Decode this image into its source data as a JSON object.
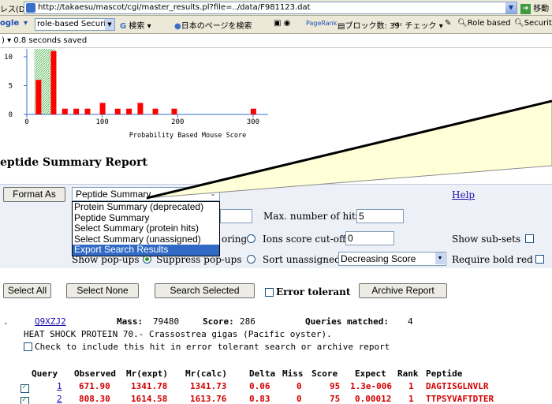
{
  "browser": {
    "address_label": "レス(D)",
    "url": "http://takaesu/mascot/cgi/master_results.pl?file=../data/F981123.dat",
    "go_label": "移動"
  },
  "toolbar": {
    "google_label": "ogle",
    "search_value": "role-based Security",
    "items": [
      "検索",
      "日本のページを検索",
      "PageRank",
      "ブロック数: 39",
      "チェック",
      "Role based",
      "Security"
    ]
  },
  "status": {
    "text": "0.8 seconds saved"
  },
  "chart_data": {
    "type": "bar",
    "xlabel": "Probability Based Mouse Score",
    "xlim": [
      0,
      320
    ],
    "ylim": [
      0,
      10
    ],
    "xticks": [
      0,
      100,
      200,
      300
    ],
    "yticks": [
      0,
      5,
      10
    ],
    "bar_color": "#ff0000",
    "shaded_region": [
      10,
      38
    ],
    "bars": [
      {
        "x": 15,
        "y": 6
      },
      {
        "x": 35,
        "y": 11
      },
      {
        "x": 50,
        "y": 1
      },
      {
        "x": 65,
        "y": 1
      },
      {
        "x": 80,
        "y": 1
      },
      {
        "x": 100,
        "y": 2
      },
      {
        "x": 120,
        "y": 1
      },
      {
        "x": 135,
        "y": 1
      },
      {
        "x": 150,
        "y": 2
      },
      {
        "x": 170,
        "y": 1
      },
      {
        "x": 195,
        "y": 1
      },
      {
        "x": 300,
        "y": 1
      }
    ]
  },
  "report": {
    "title": "eptide Summary Report",
    "format_as_label": "Format As",
    "format_selected": "Peptide Summary",
    "format_options": [
      "Protein Summary (deprecated)",
      "Peptide Summary",
      "Select Summary (protein hits)",
      "Select Summary (unassigned)",
      "Export Search Results"
    ],
    "help_label": "Help",
    "max_hits_label": "Max. number of hits",
    "max_hits_value": "5",
    "scoring_tail": "oring",
    "ions_cutoff_label": "Ions score cut-off",
    "ions_cutoff_value": "0",
    "show_subsets_label": "Show sub-sets",
    "show_popups_label": "Show pop-ups",
    "suppress_popups_label": "Suppress pop-ups",
    "sort_unassigned_label": "Sort unassigned",
    "sort_unassigned_value": "Decreasing Score",
    "require_bold_red_label": "Require bold red"
  },
  "actions": {
    "select_all": "Select All",
    "select_none": "Select None",
    "search_selected": "Search Selected",
    "error_tolerant": "Error tolerant",
    "archive_report": "Archive Report"
  },
  "hit": {
    "accession": "Q9XZJ2",
    "mass_label": "Mass:",
    "mass": "79480",
    "score_label": "Score:",
    "score": "286",
    "queries_label": "Queries matched:",
    "queries": "4",
    "description": "HEAT SHOCK PROTEIN 70.- Crassostrea gigas (Pacific oyster).",
    "checkbox_label": "Check to include this hit in error tolerant search or archive report"
  },
  "peptide_table": {
    "headers": [
      "Query",
      "Observed",
      "Mr(expt)",
      "Mr(calc)",
      "Delta",
      "Miss",
      "Score",
      "Expect",
      "Rank",
      "Peptide"
    ],
    "rows": [
      [
        "1",
        "671.90",
        "1341.78",
        "1341.73",
        "0.06",
        "0",
        "95",
        "1.3e-006",
        "1",
        "DAGTISGLNVLR"
      ],
      [
        "2",
        "808.30",
        "1614.58",
        "1613.76",
        "0.83",
        "0",
        "75",
        "0.00012",
        "1",
        "TTPSYVAFTDTER"
      ]
    ]
  }
}
